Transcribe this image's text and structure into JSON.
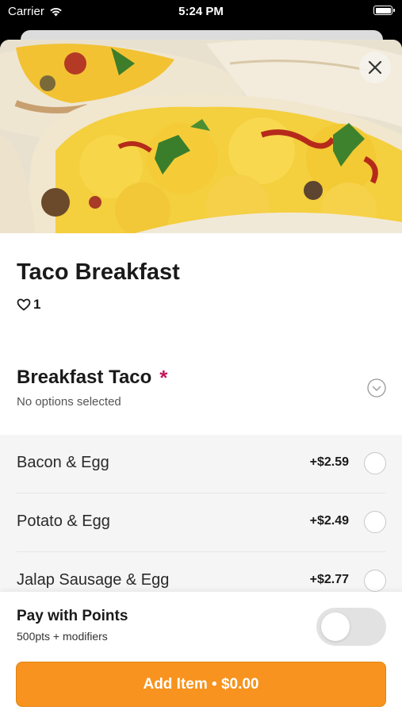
{
  "status_bar": {
    "carrier": "Carrier",
    "time": "5:24 PM",
    "icons": [
      "wifi-icon",
      "battery-icon"
    ]
  },
  "item": {
    "title": "Taco Breakfast",
    "likes": "1"
  },
  "option_group": {
    "title": "Breakfast Taco",
    "required_mark": "*",
    "subtitle": "No options selected",
    "options": [
      {
        "name": "Bacon & Egg",
        "price": "+$2.59"
      },
      {
        "name": "Potato & Egg",
        "price": "+$2.49"
      },
      {
        "name": "Jalap Sausage & Egg",
        "price": "+$2.77"
      }
    ]
  },
  "points": {
    "title": "Pay with Points",
    "subtitle": "500pts + modifiers",
    "enabled": false
  },
  "add_button": {
    "label": "Add Item • $0.00"
  },
  "colors": {
    "accent": "#f7931e",
    "required": "#c2185b"
  }
}
